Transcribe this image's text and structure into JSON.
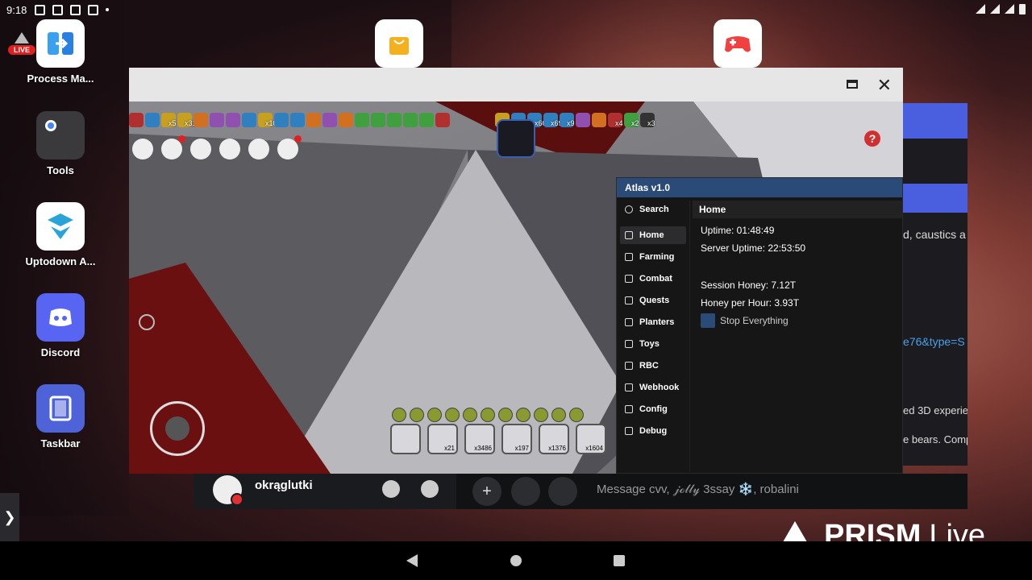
{
  "statusbar": {
    "time": "9:18"
  },
  "desktop": {
    "live_badge": "LIVE",
    "icons": [
      {
        "label": "Process Ma..."
      },
      {
        "label": "Tools"
      },
      {
        "label": "Uptodown A..."
      },
      {
        "label": "Discord"
      },
      {
        "label": "Taskbar"
      }
    ]
  },
  "game": {
    "buff_counts": [
      "x5",
      "x31",
      "x100",
      "x3",
      "x60",
      "x69",
      "x9",
      "x4",
      "x2",
      "x3"
    ],
    "hotbar_counts": [
      "x21",
      "x3486",
      "x197",
      "x1376",
      "x1604"
    ],
    "help_label": "?"
  },
  "atlas": {
    "title": "Atlas v1.0",
    "search_label": "Search",
    "nav": [
      "Home",
      "Farming",
      "Combat",
      "Quests",
      "Planters",
      "Toys",
      "RBC",
      "Webhook",
      "Config",
      "Debug"
    ],
    "section_title": "Home",
    "uptime": "Uptime: 01:48:49",
    "server_uptime": "Server Uptime: 22:53:50",
    "session_honey": "Session Honey: 7.12T",
    "honey_per_hour": "Honey per Hour: 3.93T",
    "stop_label": "Stop Everything"
  },
  "behind_window": {
    "line1": "d, caustics a",
    "line2": "e76&type=S",
    "line3": "ed 3D experie",
    "line4": "e bears. Comp"
  },
  "discord_bar": {
    "username": "okrąglutki",
    "message_placeholder": "Message cvv, 𝒿ℴ𝓁𝓁𝓎 3ssay ❄️, robalini",
    "plus": "+"
  },
  "side_arrow": "❯",
  "watermark": {
    "brand": "PRISM",
    "suffix": "Live"
  }
}
